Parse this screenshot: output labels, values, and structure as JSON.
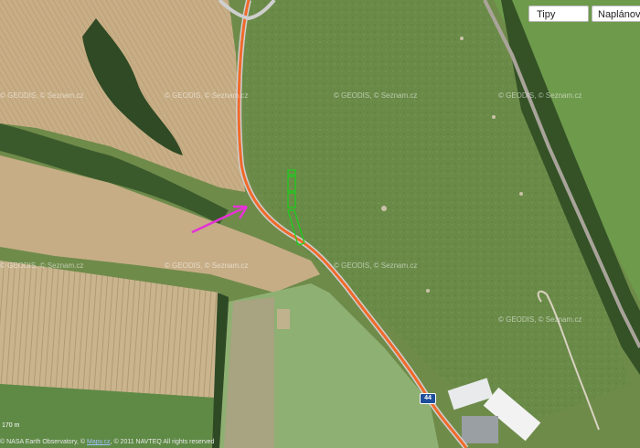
{
  "toolbar": {
    "tips_label": "Tipy",
    "plan_label": "Naplánovat"
  },
  "watermarks": [
    "© GEODIS, © Seznam.cz",
    "© GEODIS, © Seznam.cz",
    "© GEODIS, © Seznam.cz",
    "© GEODIS, © Seznam.cz",
    "© GEODIS, © Seznam.cz",
    "© GEODIS, © Seznam.cz",
    "© GEODIS, © Seznam.cz",
    "© GEODIS, © Seznam.cz"
  ],
  "road": {
    "number": "44",
    "color": "#f06a2a"
  },
  "annotations": {
    "arrow_color": "#e632d6",
    "marker_color": "#19d219"
  },
  "scale_label": "170 m",
  "copyright": {
    "prefix": "© NASA Earth Observatory, ©",
    "link": "Mapy.cz",
    "suffix": ", © 2011 NAVTEQ All rights reserved"
  }
}
